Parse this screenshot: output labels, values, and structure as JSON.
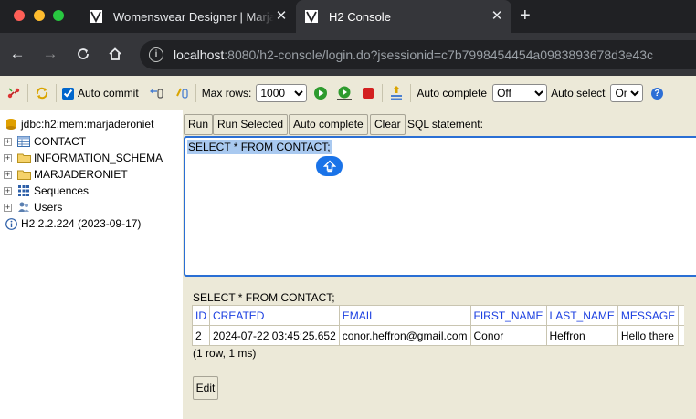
{
  "browser": {
    "tabs": [
      {
        "title": "Womenswear Designer | Marjaderoniet"
      },
      {
        "title": "H2 Console"
      }
    ],
    "new_tab_glyph": "+",
    "close_glyph": "✕",
    "url_host": "localhost",
    "url_rest": ":8080/h2-console/login.do?jsessionid=c7b7998454454a0983893678d3e43c"
  },
  "toolbar": {
    "auto_commit_label": "Auto commit",
    "auto_commit_checked": true,
    "max_rows_label": "Max rows:",
    "max_rows_value": "1000",
    "auto_complete_label": "Auto complete",
    "auto_complete_value": "Off",
    "auto_select_label": "Auto select",
    "auto_select_value": "On",
    "help_glyph": "?"
  },
  "tree": {
    "connection": "jdbc:h2:mem:marjaderoniet",
    "items": [
      {
        "label": "CONTACT"
      },
      {
        "label": "INFORMATION_SCHEMA"
      },
      {
        "label": "MARJADERONIET"
      },
      {
        "label": "Sequences"
      },
      {
        "label": "Users"
      }
    ],
    "version": "H2 2.2.224 (2023-09-17)"
  },
  "query": {
    "buttons": {
      "run": "Run",
      "run_selected": "Run Selected",
      "auto_complete": "Auto complete",
      "clear": "Clear"
    },
    "sql_label": "SQL statement:",
    "sql_text": "SELECT * FROM CONTACT;"
  },
  "result": {
    "statement": "SELECT * FROM CONTACT;",
    "columns": [
      "ID",
      "CREATED",
      "EMAIL",
      "FIRST_NAME",
      "LAST_NAME",
      "MESSAGE"
    ],
    "rows": [
      [
        "2",
        "2024-07-22 03:45:25.652",
        "conor.heffron@gmail.com",
        "Conor",
        "Heffron",
        "Hello there"
      ]
    ],
    "summary": "(1 row, 1 ms)",
    "edit_label": "Edit"
  },
  "colors": {
    "panel_bg": "#ece9d8",
    "selection": "#a9c9f0",
    "editor_focus": "#2a6fd4",
    "column_header": "#1a3ee0"
  }
}
